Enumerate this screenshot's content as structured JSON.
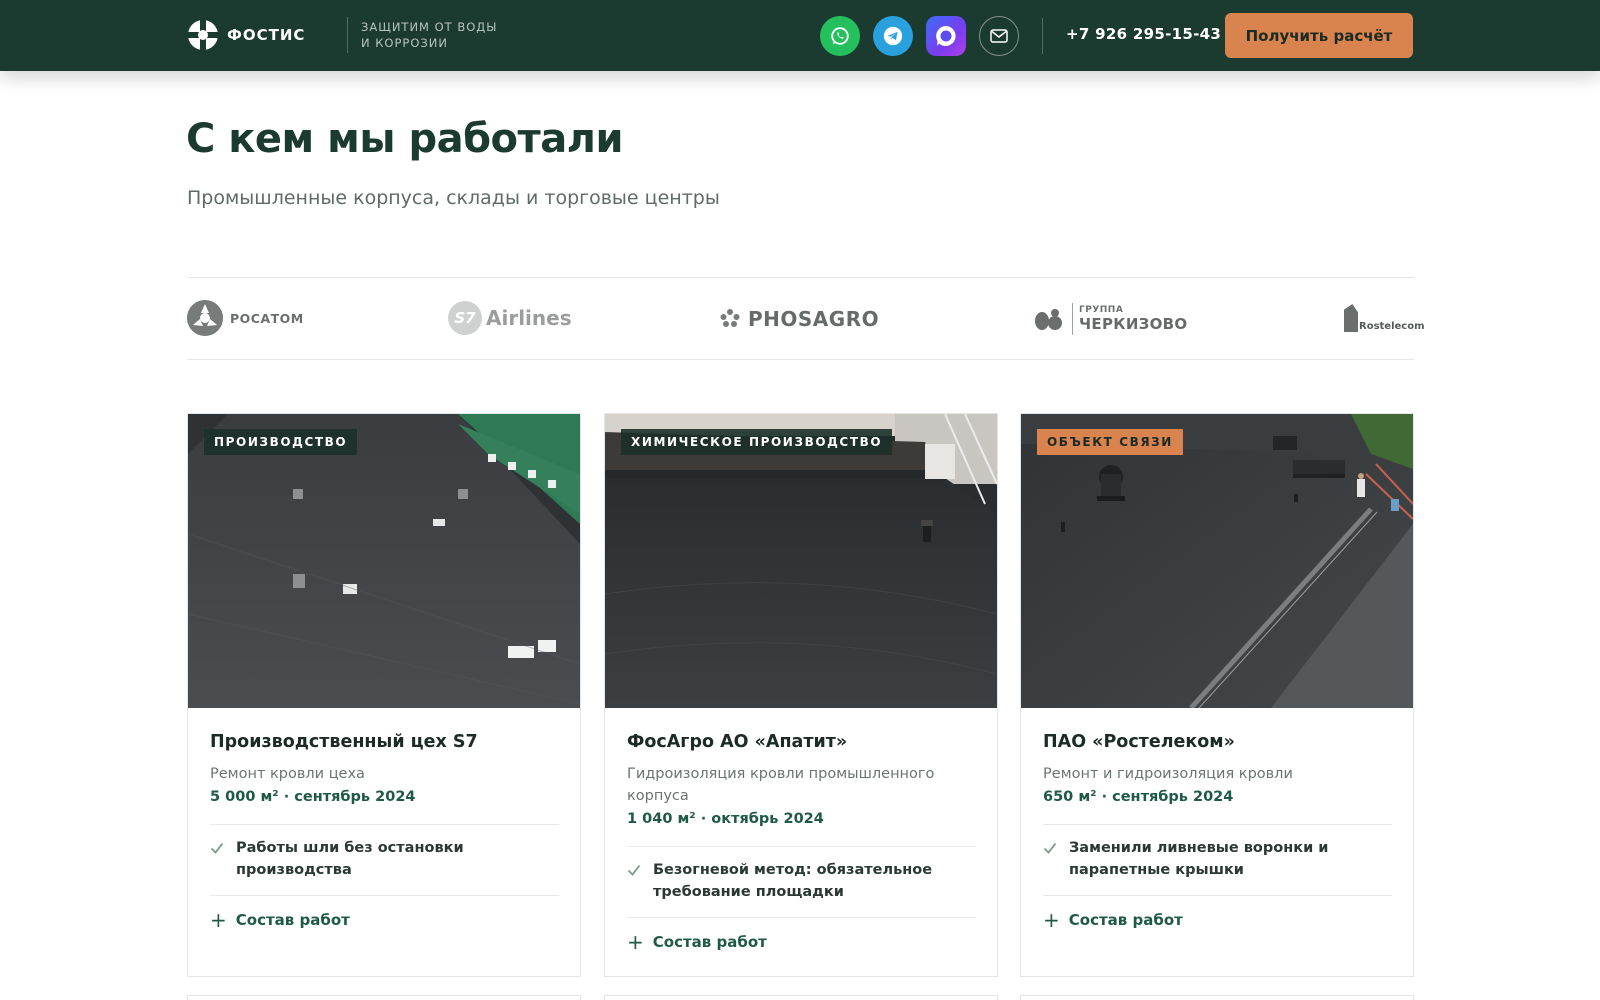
{
  "header": {
    "logo_text": "ФОСТИС",
    "tagline_line1": "ЗАЩИТИМ ОТ ВОДЫ",
    "tagline_line2": "И КОРРОЗИИ",
    "phone": "+7 926 295-15-43",
    "cta_label": "Получить расчёт",
    "social_icons": [
      "whatsapp-icon",
      "telegram-icon",
      "max-messenger-icon",
      "mail-icon"
    ]
  },
  "section": {
    "title": "С кем мы работали",
    "subtitle": "Промышленные корпуса, склады и торговые центры"
  },
  "brands": {
    "rosatom": "РОСАТОМ",
    "s7_mark": "S7",
    "s7": "Airlines",
    "phosagro": "PHOSAGRO",
    "cherkizovo_small": "ГРУППА",
    "cherkizovo": "ЧЕРКИЗОВО",
    "rostelecom": "Rostelecom"
  },
  "cards": [
    {
      "tag": "производство",
      "title": "Производственный цех S7",
      "desc": "Ремонт кровли цеха",
      "meta": "5 000 м² · сентябрь 2024",
      "feature": "Работы шли без остановки производства",
      "more": "Состав работ"
    },
    {
      "tag": "химическое производство",
      "title": "ФосАгро АО «Апатит»",
      "desc": "Гидроизоляция кровли промышленного корпуса",
      "meta": "1 040 м² · октябрь 2024",
      "feature": "Безогневой метод: обязательное требование площадки",
      "more": "Состав работ"
    },
    {
      "tag": "объект связи",
      "title": "ПАО «Ростелеком»",
      "desc": "Ремонт и гидроизоляция кровли",
      "meta": "650 м² · сентябрь 2024",
      "feature": "Заменили ливневые воронки и парапетные крышки",
      "more": "Состав работ"
    }
  ],
  "colors": {
    "header_bg": "#1b3a30",
    "accent_orange": "#d9834e",
    "accent_green": "#1e5a47"
  }
}
